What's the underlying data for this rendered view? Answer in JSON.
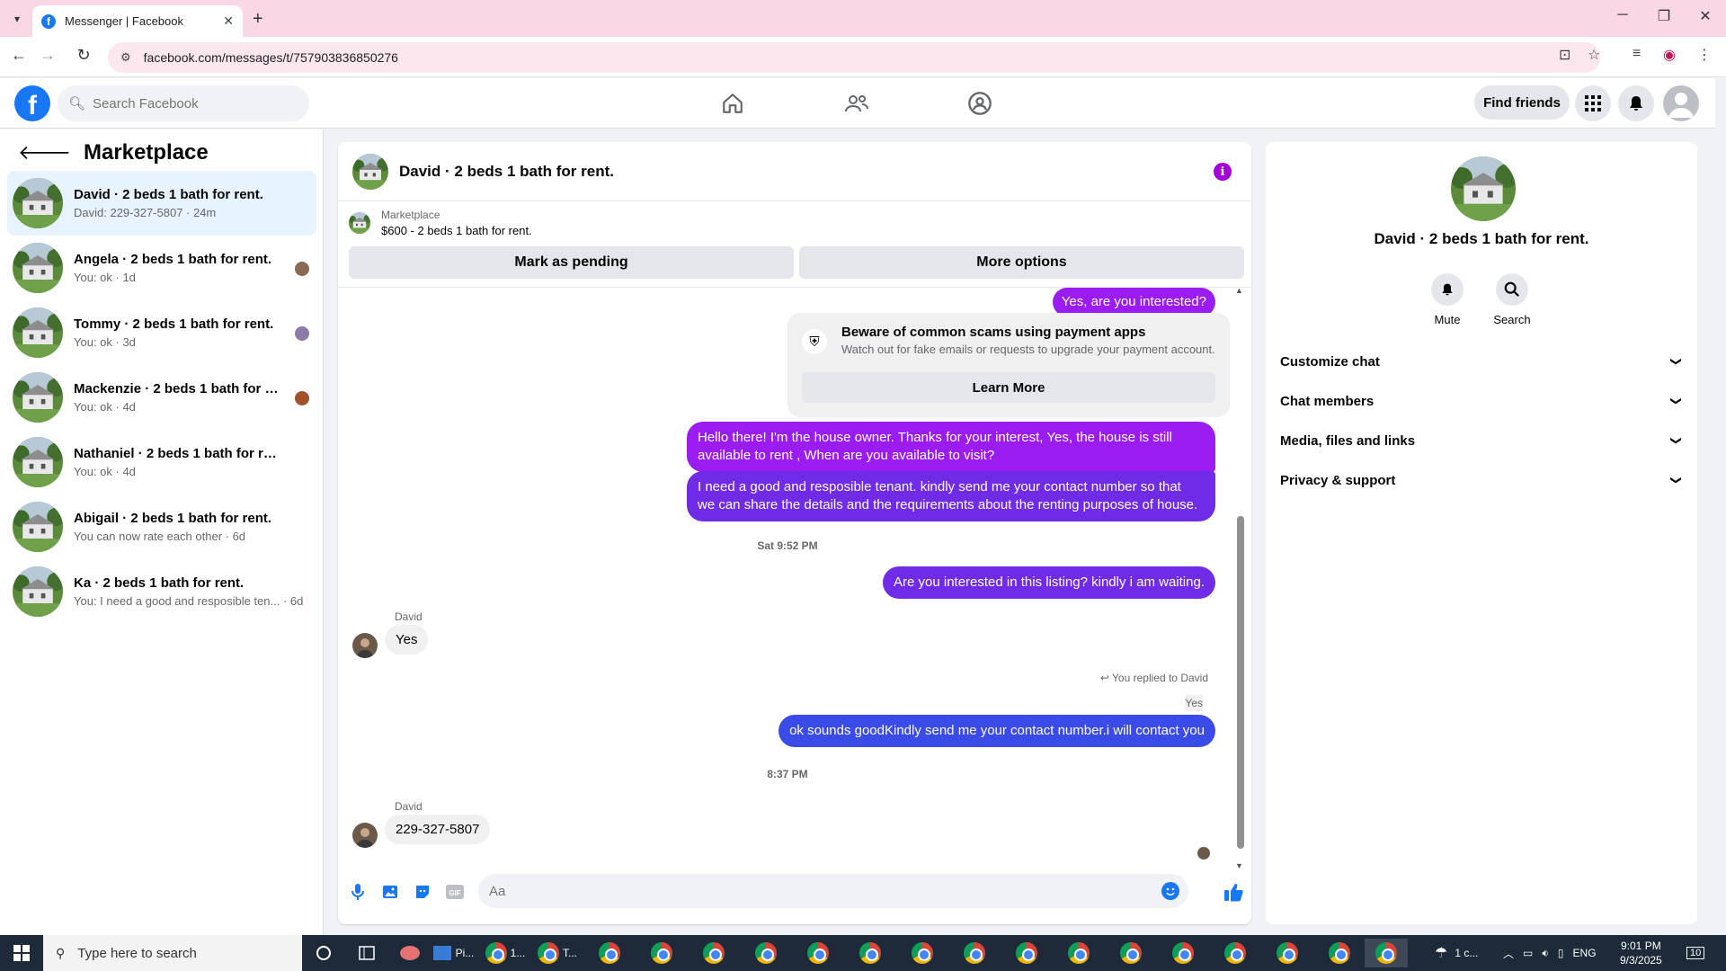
{
  "browser": {
    "tab_title": "Messenger | Facebook",
    "url": "facebook.com/messages/t/757903836850276"
  },
  "fb": {
    "search_placeholder": "Search Facebook",
    "find_friends": "Find friends"
  },
  "left": {
    "title": "Marketplace",
    "chats": [
      {
        "name": "David · 2 beds 1 bath for rent.",
        "preview": "David: 229-327-5807 · 24m"
      },
      {
        "name": "Angela · 2 beds 1 bath for rent.",
        "preview": "You: ok · 1d"
      },
      {
        "name": "Tommy · 2 beds 1 bath for rent.",
        "preview": "You: ok · 3d"
      },
      {
        "name": "Mackenzie · 2 beds 1 bath for re...",
        "preview": "You: ok · 4d"
      },
      {
        "name": "Nathaniel · 2 beds 1 bath for rent.",
        "preview": "You: ok · 4d"
      },
      {
        "name": "Abigail · 2 beds 1 bath for rent.",
        "preview": "You can now rate each other · 6d"
      },
      {
        "name": "Ka · 2 beds 1 bath for rent.",
        "preview": "You: I need a good and resposible ten... · 6d"
      }
    ]
  },
  "convo": {
    "title": "David · 2 beds 1 bath for rent.",
    "marketplace_label": "Marketplace",
    "listing": "$600 - 2 beds 1 bath for rent.",
    "mark_pending": "Mark as pending",
    "more_options": "More options",
    "msg_interested": "Yes, are you interested?",
    "scam_title": "Beware of common scams using payment apps",
    "scam_desc": "Watch out for fake emails or requests to upgrade your payment account.",
    "learn_more": "Learn More",
    "msg_owner_1": "Hello there! I'm the house owner. Thanks for your interest, Yes, the house is still",
    "msg_owner_2": "available to rent , When are you available to visit?",
    "msg_tenant_1": "I need a good and resposible tenant.  kindly send me your contact number so that",
    "msg_tenant_2": "we can share the details and the requirements about the renting purposes of house.",
    "time_1": "Sat 9:52 PM",
    "msg_waiting": "Are you interested in this listing? kindly i am waiting.",
    "sender_1": "David",
    "msg_yes": "Yes",
    "replied_to": "You replied to David",
    "reply_quote": "Yes",
    "msg_ok": "ok sounds goodKindly send me your contact number.i will contact you",
    "time_2": "8:37 PM",
    "sender_2": "David",
    "msg_phone": "229-327-5807",
    "composer_placeholder": "Aa"
  },
  "right": {
    "name": "David · 2 beds 1 bath for rent.",
    "mute": "Mute",
    "search": "Search",
    "sections": [
      "Customize chat",
      "Chat members",
      "Media, files and links",
      "Privacy & support"
    ]
  },
  "taskbar": {
    "search_placeholder": "Type here to search",
    "app_1": "Pi...",
    "app_2": "1...",
    "app_3": "T...",
    "weather": "1 c...",
    "lang": "ENG",
    "time": "9:01 PM",
    "date": "9/3/2025",
    "notif": "10"
  },
  "colors": {
    "fb_blue": "#1877f2",
    "msg_purple": "#9b1cf0",
    "msg_indigo": "#6f2be6",
    "msg_blue": "#3a4be8",
    "info_purple": "#a400d6"
  }
}
